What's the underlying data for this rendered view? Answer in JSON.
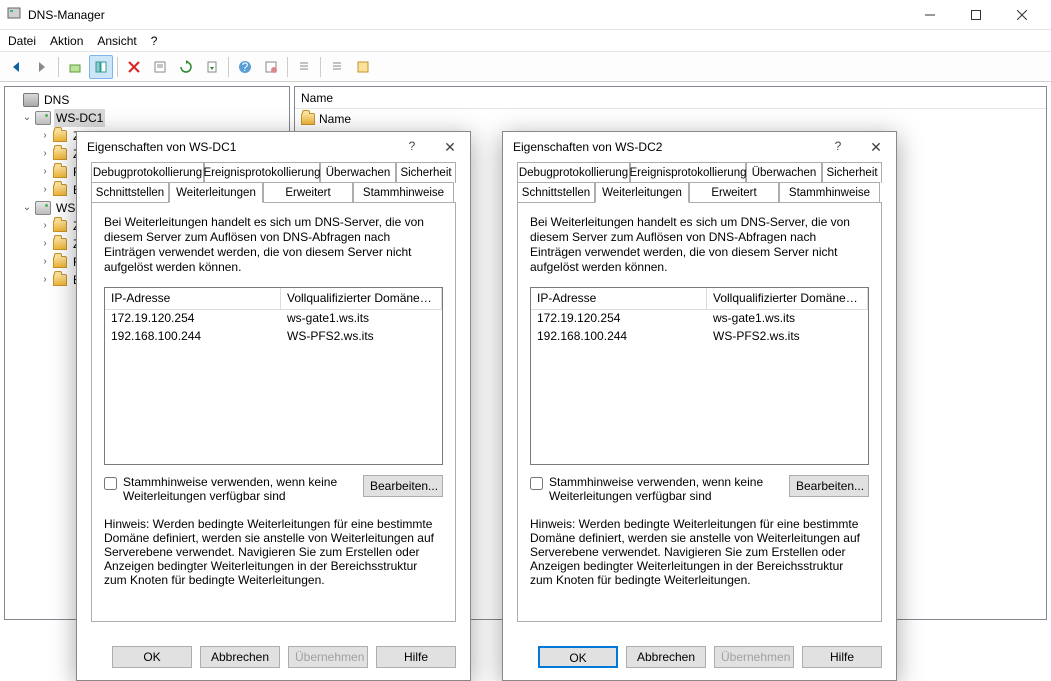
{
  "window": {
    "title": "DNS-Manager"
  },
  "menubar": {
    "file": "Datei",
    "action": "Aktion",
    "view": "Ansicht",
    "help": "?"
  },
  "tree": {
    "root": "DNS",
    "server1": "WS-DC1",
    "s1_a": "Z",
    "s1_b": "Z",
    "s1_c": "F",
    "s1_d": "E",
    "server2": "WS-I",
    "s2_a": "Z",
    "s2_b": "Z",
    "s2_c": "F",
    "s2_d": "E"
  },
  "content": {
    "header": "Name",
    "row1": "Name"
  },
  "dialog_common": {
    "tabs": {
      "debug": "Debugprotokollierung",
      "event": "Ereignisprotokollierung",
      "monitor": "Überwachen",
      "security": "Sicherheit",
      "interfaces": "Schnittstellen",
      "forwarders": "Weiterleitungen",
      "advanced": "Erweitert",
      "roothints": "Stammhinweise"
    },
    "desc": "Bei Weiterleitungen handelt es sich um DNS-Server, die von diesem Server zum Auflösen von DNS-Abfragen nach Einträgen verwendet werden, die von diesem Server nicht aufgelöst werden können.",
    "col_ip": "IP-Adresse",
    "col_fqdn": "Vollqualifizierter Domänenname f...",
    "rows": [
      {
        "ip": "172.19.120.254",
        "fqdn": "ws-gate1.ws.its"
      },
      {
        "ip": "192.168.100.244",
        "fqdn": "WS-PFS2.ws.its"
      }
    ],
    "chk_label": "Stammhinweise verwenden, wenn keine Weiterleitungen verfügbar sind",
    "edit_label": "Bearbeiten...",
    "hint": "Hinweis: Werden bedingte Weiterleitungen für eine bestimmte Domäne definiert, werden sie anstelle von Weiterleitungen auf Serverebene verwendet. Navigieren Sie zum Erstellen oder Anzeigen bedingter Weiterleitungen in der Bereichsstruktur zum Knoten für bedingte Weiterleitungen.",
    "ok": "OK",
    "cancel": "Abbrechen",
    "apply": "Übernehmen",
    "help": "Hilfe"
  },
  "dialog1": {
    "title": "Eigenschaften von WS-DC1"
  },
  "dialog2": {
    "title": "Eigenschaften von WS-DC2"
  }
}
